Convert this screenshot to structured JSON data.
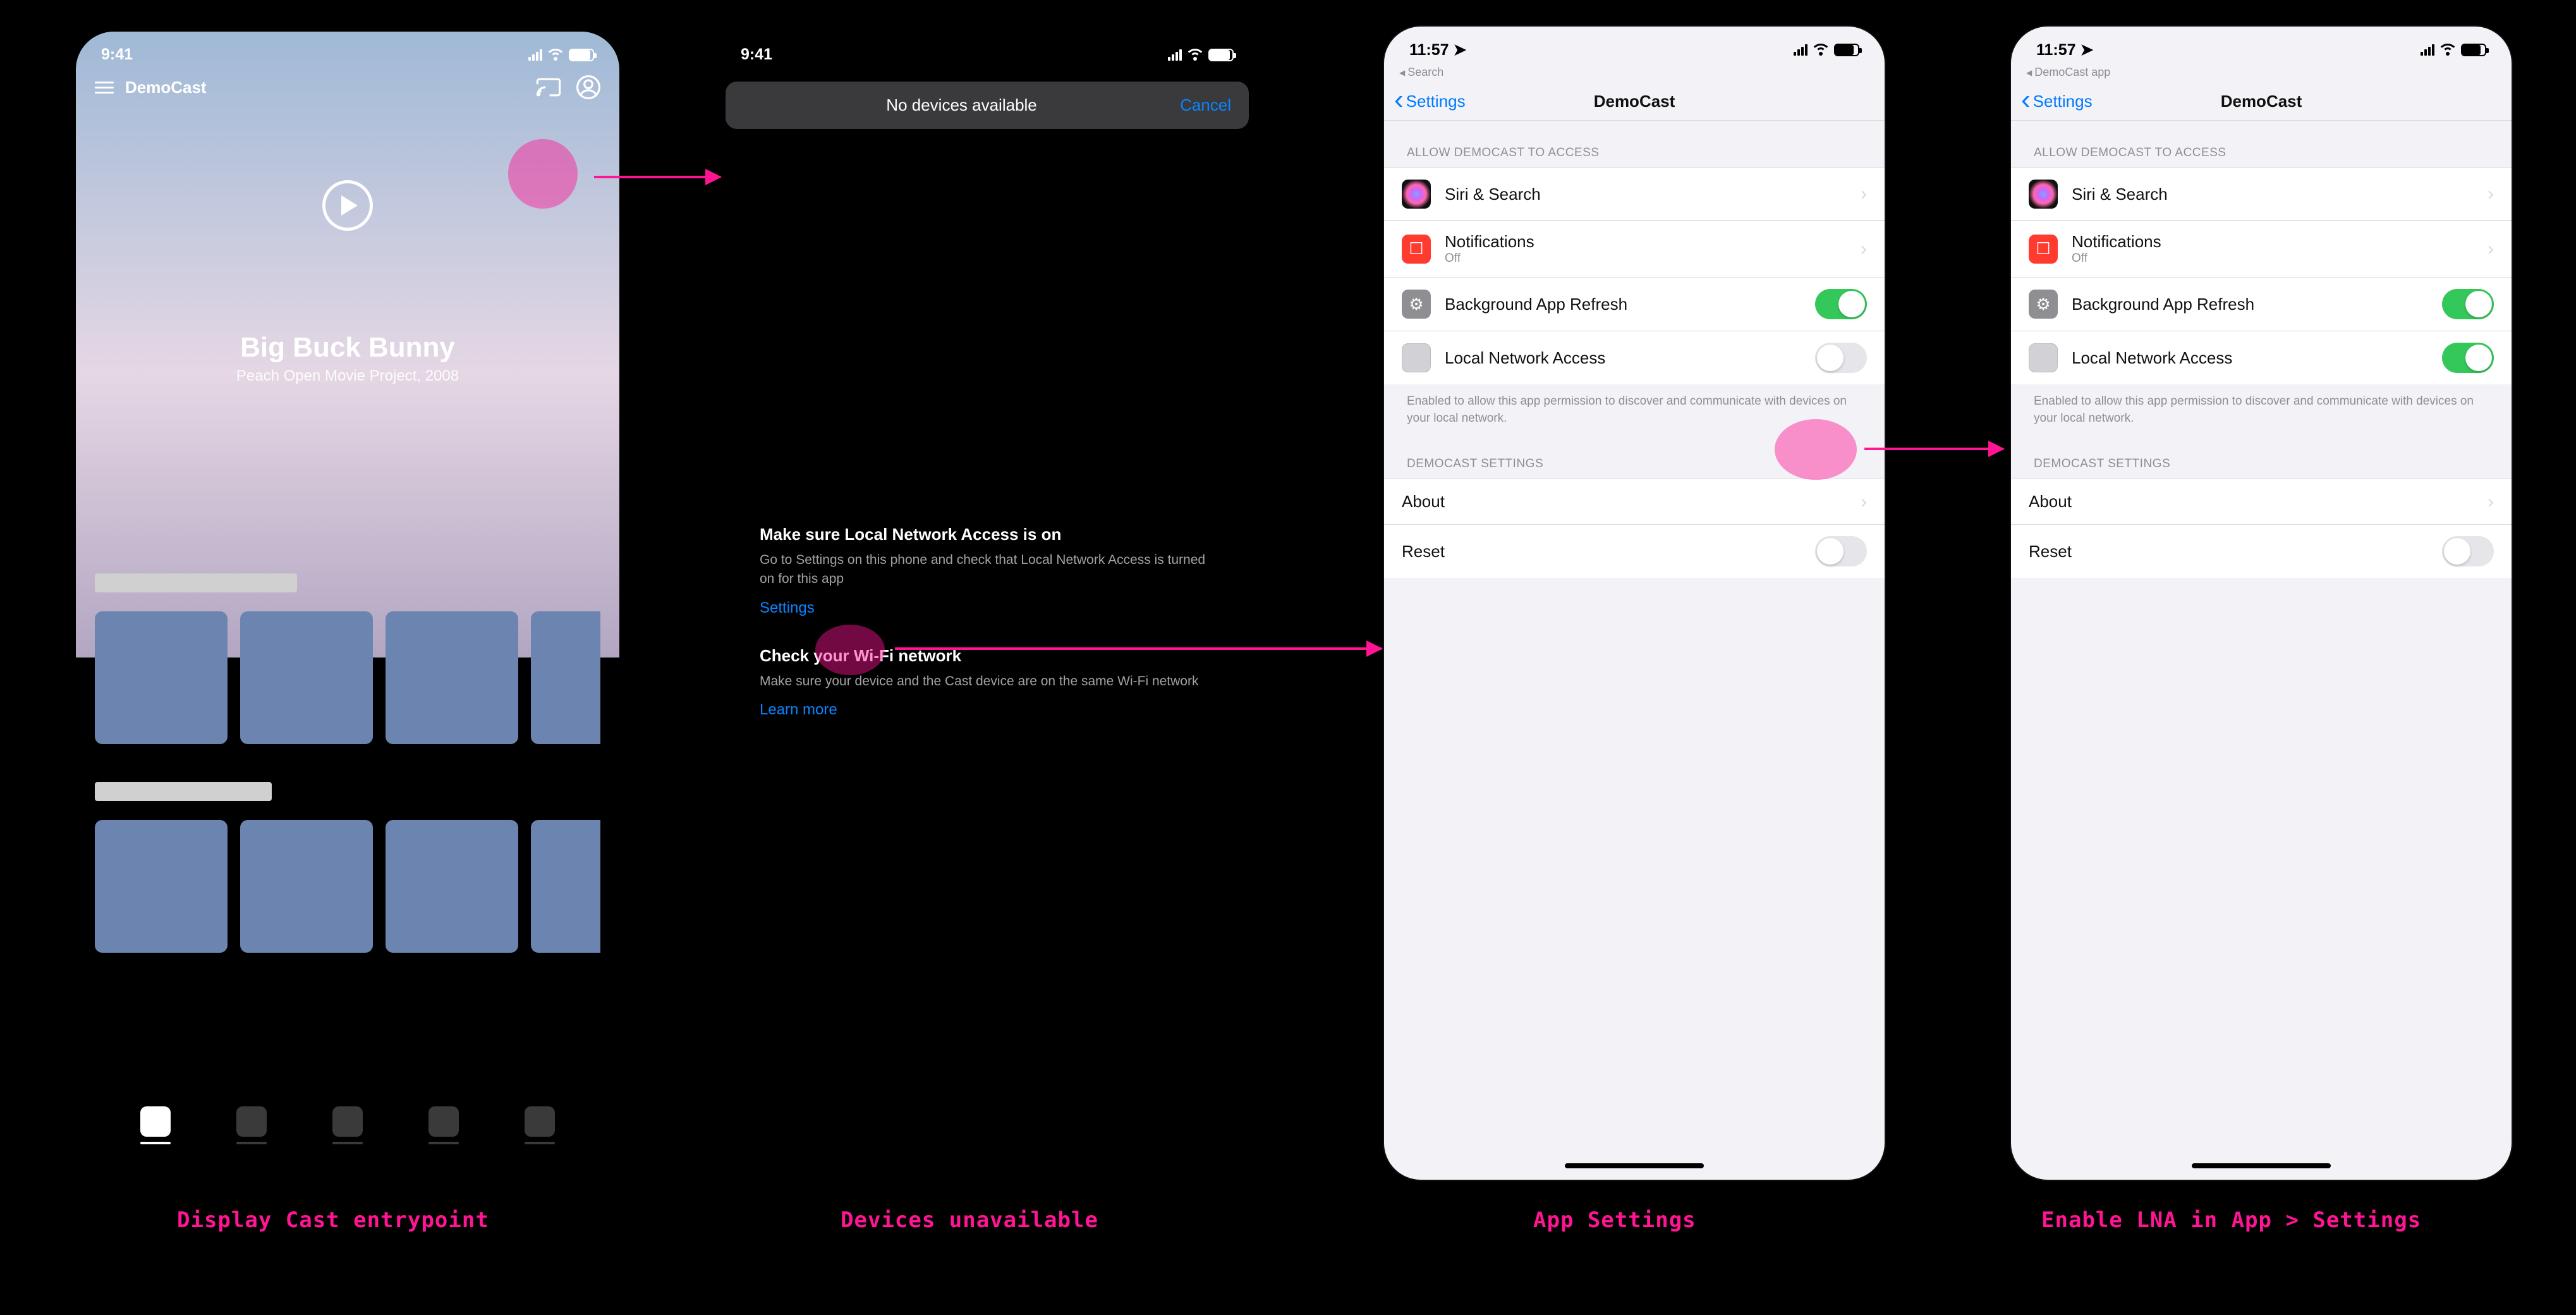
{
  "colors": {
    "accent_pink": "#ff1493",
    "ios_blue": "#007aff",
    "ios_green": "#34c759"
  },
  "captions": {
    "s1": "Display Cast entrypoint",
    "s2": "Devices unavailable",
    "s3": "App Settings",
    "s4": "Enable LNA in App > Settings"
  },
  "common": {
    "time_941": "9:41",
    "time_1157": "11:57"
  },
  "screen1": {
    "app_name": "DemoCast",
    "hero_title": "Big Buck Bunny",
    "hero_subtitle": "Peach Open Movie Project, 2008",
    "icons": {
      "menu": "hamburger-icon",
      "cast": "cast-icon",
      "profile": "profile-icon",
      "play": "play-icon"
    },
    "tabbar_items": 5,
    "tabbar_active_index": 0
  },
  "screen2": {
    "sheet_title": "No devices available",
    "sheet_cancel": "Cancel",
    "h1": "Make sure Local Network Access is on",
    "p1": "Go to Settings on this phone and check that Local Network Access is turned on for this app",
    "settings_link": "Settings",
    "h2": "Check your Wi-Fi network",
    "p2": "Make sure your device and the Cast device are on the same Wi-Fi network",
    "learn_more": "Learn more"
  },
  "settings_common": {
    "breadcrumbs": {
      "s3": "Search",
      "s4": "DemoCast app"
    },
    "back_label": "Settings",
    "page_title": "DemoCast",
    "section_access": "ALLOW DEMOCAST TO ACCESS",
    "section_app": "DEMOCAST SETTINGS",
    "rows_access": [
      {
        "id": "siri",
        "label": "Siri & Search",
        "type": "disclosure",
        "icon": "siri"
      },
      {
        "id": "notifications",
        "label": "Notifications",
        "sublabel": "Off",
        "type": "disclosure",
        "icon": "notif"
      },
      {
        "id": "bg_refresh",
        "label": "Background App Refresh",
        "type": "toggle",
        "icon": "refresh"
      },
      {
        "id": "lna",
        "label": "Local Network Access",
        "type": "toggle",
        "icon": "lna"
      }
    ],
    "lna_footnote": "Enabled to allow this app permission to discover and communicate with devices on your local network.",
    "rows_app": [
      {
        "id": "about",
        "label": "About",
        "type": "disclosure"
      },
      {
        "id": "reset",
        "label": "Reset",
        "type": "toggle"
      }
    ]
  },
  "screen3": {
    "toggles": {
      "bg_refresh": true,
      "lna": false,
      "reset": false
    }
  },
  "screen4": {
    "toggles": {
      "bg_refresh": true,
      "lna": true,
      "reset": false
    }
  }
}
